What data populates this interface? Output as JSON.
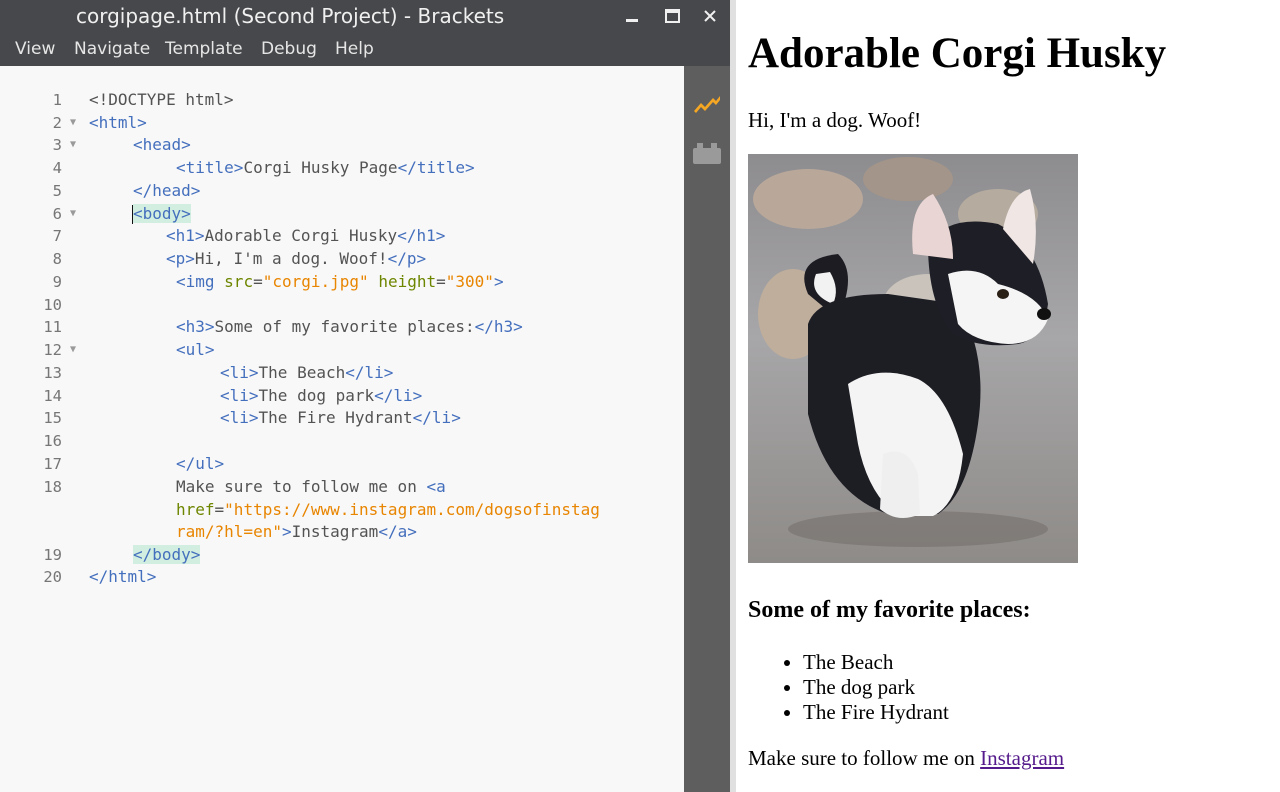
{
  "window": {
    "title": "corgipage.html (Second Project) - Brackets"
  },
  "menu": [
    "View",
    "Navigate",
    "Template",
    "Debug",
    "Help"
  ],
  "editor": {
    "line_numbers": [
      "1",
      "2",
      "3",
      "4",
      "5",
      "6",
      "7",
      "8",
      "9",
      "10",
      "11",
      "12",
      "13",
      "14",
      "15",
      "16",
      "17",
      "18",
      "19",
      "20"
    ],
    "lines": {
      "l1": "<!DOCTYPE html>",
      "l2": "<html>",
      "l3": "<head>",
      "l4_open": "<title>",
      "l4_text": "Corgi Husky Page",
      "l4_close": "</title>",
      "l5": "</head>",
      "l6": "<body>",
      "l7_open": "<h1>",
      "l7_text": "Adorable Corgi Husky",
      "l7_close": "</h1>",
      "l8_open": "<p>",
      "l8_text": "Hi, I'm a dog. Woof!",
      "l8_close": "</p>",
      "l9_tag": "<img",
      "l9_attr1": "src",
      "l9_eq1": "=",
      "l9_val1": "\"corgi.jpg\"",
      "l9_attr2": "height",
      "l9_eq2": "=",
      "l9_val2": "\"300\"",
      "l9_end": ">",
      "l11_open": "<h3>",
      "l11_text": "Some of my favorite places:",
      "l11_close": "</h3>",
      "l12": "<ul>",
      "l13_open": "<li>",
      "l13_text": "The Beach",
      "l13_close": "</li>",
      "l14_open": "<li>",
      "l14_text": "The dog park",
      "l14_close": "</li>",
      "l15_open": "<li>",
      "l15_text": "The Fire Hydrant",
      "l15_close": "</li>",
      "l17": "</ul>",
      "l18_text": "Make sure to follow me on ",
      "l18_tag": "<a",
      "l18b_attr": "href",
      "l18b_eq": "=",
      "l18b_val": "\"https://www.instagram.com/dogsofinstag",
      "l18c_val": "ram/?hl=en\"",
      "l18c_gt": ">",
      "l18c_text": "Instagram",
      "l18c_close": "</a>",
      "l19": "</body>",
      "l20": "</html>"
    }
  },
  "toolbar_icons": [
    "live-preview-icon",
    "extension-manager-icon"
  ],
  "preview": {
    "h1": "Adorable Corgi Husky",
    "p": "Hi, I'm a dog. Woof!",
    "h3": "Some of my favorite places:",
    "list": [
      "The Beach",
      "The dog park",
      "The Fire Hydrant"
    ],
    "follow_text": "Make sure to follow me on ",
    "link_text": "Instagram"
  },
  "colors": {
    "titlebar": "#47484b",
    "editor_bg": "#f8f8f8",
    "tag": "#446fbd",
    "attribute": "#6d8600",
    "string": "#e88501",
    "tag_match_highlight": "#d2eee0",
    "live_preview_icon": "#f5a623",
    "visited_link": "#551a8b"
  }
}
